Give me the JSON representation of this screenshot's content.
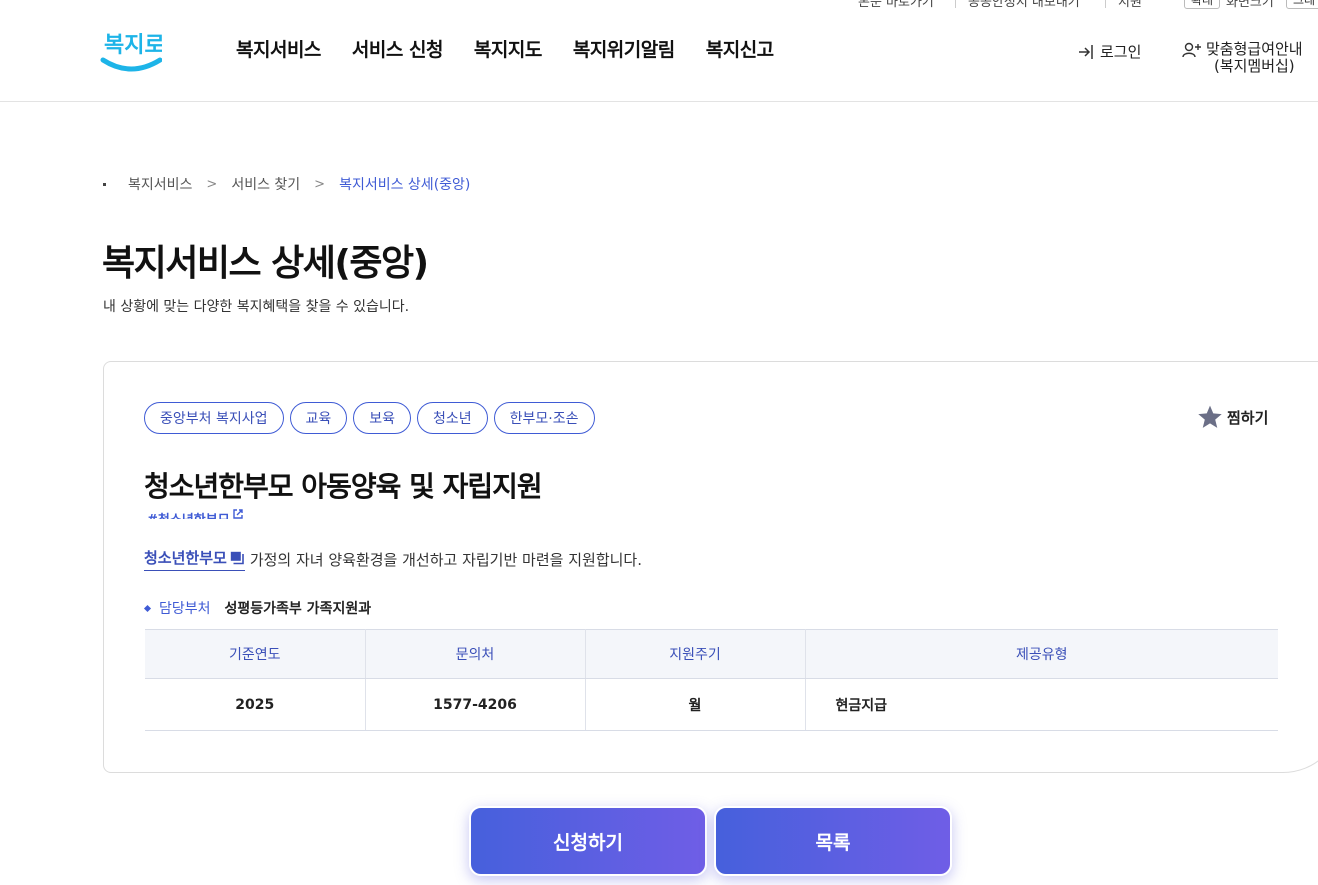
{
  "utility": {
    "items": [
      "본문 바로가기",
      "공공안정지 내보내기",
      "지원"
    ],
    "buttons": [
      "확대",
      "화면크기",
      "그레"
    ]
  },
  "header": {
    "logo_text": "복지로",
    "nav": [
      "복지서비스",
      "서비스 신청",
      "복지지도",
      "복지위기알림",
      "복지신고"
    ],
    "login": "로그인",
    "member_line1": "맞춤형급여안내",
    "member_line2": "(복지멤버십)"
  },
  "breadcrumb": [
    "복지서비스",
    "서비스 찾기",
    "복지서비스 상세(중앙)"
  ],
  "page": {
    "title": "복지서비스 상세(중앙)",
    "description": "내 상황에 맞는 다양한 복지혜택을 찾을 수 있습니다."
  },
  "service": {
    "tags": [
      "중앙부처 복지사업",
      "교육",
      "보육",
      "청소년",
      "한부모·조손"
    ],
    "bookmark": "찜하기",
    "title": "청소년한부모 아동양육 및 자립지원",
    "hashtag": "#청소년한부모",
    "description_link": "청소년한부모",
    "description_text": "가정의 자녀 양육환경을 개선하고 자립기반 마련을 지원합니다.",
    "department_label": "담당부처",
    "department_value": "성평등가족부 가족지원과",
    "table": {
      "headers": [
        "기준연도",
        "문의처",
        "지원주기",
        "제공유형"
      ],
      "row": [
        "2025",
        "1577-4206",
        "월",
        "현금지급"
      ]
    }
  },
  "actions": {
    "apply": "신청하기",
    "list": "목록"
  },
  "colors": {
    "accent": "#3f5bd5",
    "button_gradient_start": "#4660dc",
    "button_gradient_end": "#6f5ee6",
    "logo": "#1db4e8"
  }
}
